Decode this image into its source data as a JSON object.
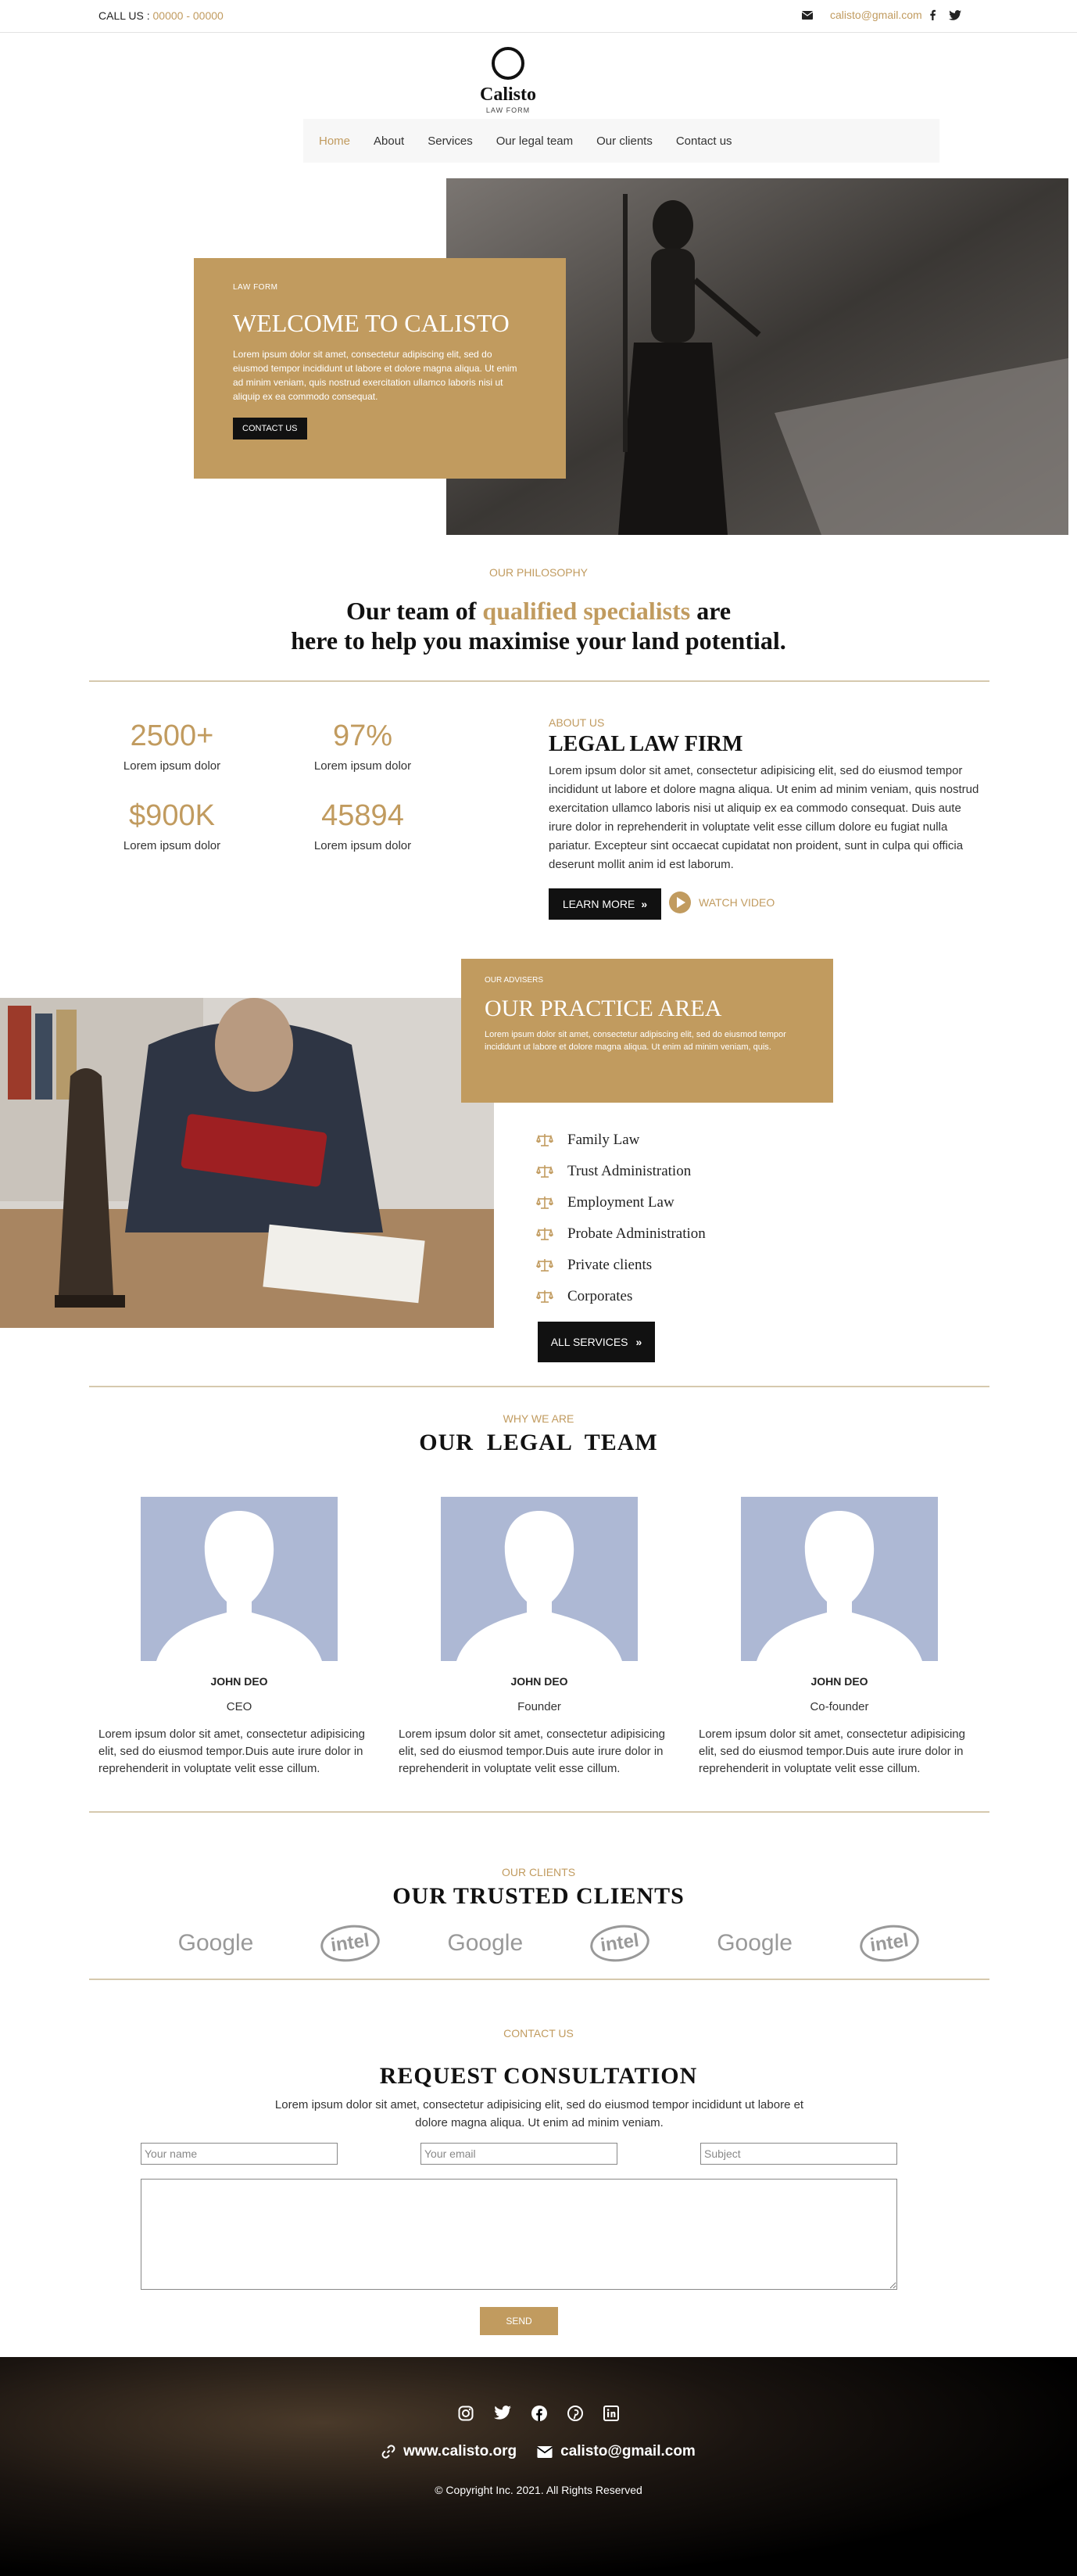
{
  "topbar": {
    "call_label": "CALL US :",
    "phone": "00000 - 00000",
    "email": "calisto@gmail.com",
    "icons": [
      "envelope-icon",
      "facebook-icon",
      "twitter-icon"
    ]
  },
  "logo": {
    "brand": "Calisto",
    "subtitle": "LAW FORM"
  },
  "nav": {
    "items": [
      "Home",
      "About",
      "Services",
      "Our legal team",
      "Our clients",
      "Contact us"
    ],
    "active": "Home"
  },
  "hero": {
    "pre": "LAW FORM",
    "title": "WELCOME TO CALISTO",
    "text": "Lorem ipsum dolor sit amet, consectetur adipiscing elit, sed do eiusmod tempor incididunt ut labore et dolore magna aliqua. Ut enim ad minim veniam, quis nostrud exercitation ullamco laboris nisi ut aliquip ex ea commodo consequat.",
    "button": "CONTACT US"
  },
  "philosophy": {
    "pre": "OUR PHILOSOPHY",
    "title_a": "Our team of ",
    "title_highlight": "qualified specialists",
    "title_b": " are",
    "title_line2": "here to help you maximise your land potential."
  },
  "stats": [
    {
      "value": "2500+",
      "label": "Lorem ipsum dolor"
    },
    {
      "value": "97%",
      "label": "Lorem ipsum dolor"
    },
    {
      "value": "$900K",
      "label": "Lorem ipsum dolor"
    },
    {
      "value": "45894",
      "label": "Lorem ipsum dolor"
    }
  ],
  "about": {
    "pre": "ABOUT US",
    "title": "LEGAL LAW FIRM",
    "text": "Lorem ipsum dolor sit amet, consectetur adipisicing elit, sed do eiusmod tempor incididunt ut labore et dolore magna aliqua. Ut enim ad minim veniam, quis nostrud exercitation ullamco laboris nisi ut aliquip ex ea commodo consequat. Duis aute irure dolor in reprehenderit in voluptate velit esse cillum dolore eu fugiat nulla pariatur. Excepteur sint occaecat cupidatat non proident, sunt in culpa qui officia deserunt mollit anim id est laborum.",
    "learn_more": "LEARN MORE",
    "watch_video": "WATCH VIDEO"
  },
  "practice": {
    "pre": "OUR ADVISERS",
    "title": "OUR PRACTICE AREA",
    "text": "Lorem ipsum dolor sit amet, consectetur adipiscing elit, sed do eiusmod tempor incididunt ut labore et dolore magna aliqua. Ut enim ad minim veniam, quis.",
    "items": [
      "Family Law",
      "Trust Administration",
      "Employment Law",
      "Probate Administration",
      "Private clients",
      "Corporates"
    ],
    "button": "ALL SERVICES"
  },
  "team": {
    "pre": "WHY WE ARE",
    "title": "OUR  LEGAL  TEAM",
    "members": [
      {
        "name": "JOHN DEO",
        "role": "CEO",
        "desc": "Lorem ipsum dolor sit amet, consectetur adipisicing elit, sed do eiusmod tempor.Duis aute irure dolor in reprehenderit in voluptate velit esse cillum."
      },
      {
        "name": "JOHN DEO",
        "role": "Founder",
        "desc": "Lorem ipsum dolor sit amet, consectetur adipisicing elit, sed do eiusmod tempor.Duis aute irure dolor in reprehenderit in voluptate velit esse cillum."
      },
      {
        "name": "JOHN DEO",
        "role": "Co-founder",
        "desc": "Lorem ipsum dolor sit amet, consectetur adipisicing elit, sed do eiusmod tempor.Duis aute irure dolor in reprehenderit in voluptate velit esse cillum."
      }
    ]
  },
  "clients": {
    "pre": "OUR CLIENTS",
    "title": "OUR TRUSTED CLIENTS",
    "logos": [
      "Google",
      "intel",
      "Google",
      "intel",
      "Google",
      "intel"
    ]
  },
  "consult": {
    "pre": "CONTACT US",
    "title": "REQUEST CONSULTATION",
    "text": "Lorem ipsum dolor sit amet, consectetur adipisicing elit, sed do eiusmod tempor incididunt ut labore et dolore magna aliqua. Ut enim ad minim veniam.",
    "name_ph": "Your name",
    "email_ph": "Your email",
    "subject_ph": "Subject",
    "send": "SEND"
  },
  "footer": {
    "social_icons": [
      "instagram-icon",
      "twitter-icon",
      "facebook-icon",
      "pinterest-icon",
      "linkedin-icon"
    ],
    "website": "www.calisto.org",
    "email": "calisto@gmail.com",
    "copyright": "© Copyright Inc. 2021. All Rights Reserved"
  },
  "colors": {
    "accent": "#c19b5f",
    "dark": "#111111",
    "avatar_bg": "#adb8d4"
  }
}
